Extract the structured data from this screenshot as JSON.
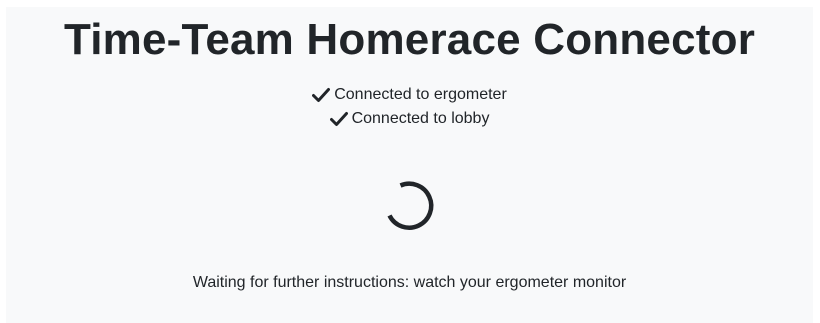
{
  "header": {
    "title": "Time-Team Homerace Connector"
  },
  "status": {
    "items": [
      {
        "icon": "check-icon",
        "label": "Connected to ergometer"
      },
      {
        "icon": "check-icon",
        "label": "Connected to lobby"
      }
    ]
  },
  "spinner": {
    "icon": "loading-spinner-icon"
  },
  "message": {
    "text": "Waiting for further instructions: watch your ergometer monitor"
  },
  "colors": {
    "text": "#212529",
    "panel_background": "#f8f9fa",
    "page_background": "#ffffff"
  }
}
